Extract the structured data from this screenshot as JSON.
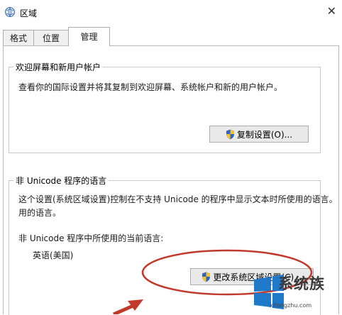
{
  "window": {
    "title": "区域",
    "close_icon": "close-icon"
  },
  "tabs": [
    {
      "label": "格式",
      "active": false
    },
    {
      "label": "位置",
      "active": false
    },
    {
      "label": "管理",
      "active": true
    }
  ],
  "welcome_group": {
    "title": "欢迎屏幕和新用户帐户",
    "description": "查看你的国际设置并将其复制到欢迎屏幕、系统帐户和新的用户帐户。",
    "copy_button": "复制设置(O)..."
  },
  "unicode_group": {
    "title": "非 Unicode 程序的语言",
    "description_line1": "这个设置(系统区域设置)控制在不支持 Unicode 的程序中显示文本时所使用的语言。",
    "description_line2": "用的语言。",
    "current_label": "非 Unicode 程序中所使用的当前语言:",
    "current_value": "英语(美国)",
    "change_button": "更改系统区域设置(C)..."
  },
  "watermark": {
    "text": "系统族",
    "url": "xitongzhu.com"
  },
  "colors": {
    "annotation": "#c0392b",
    "shield_blue": "#2e64c8",
    "shield_yellow": "#f2c230"
  }
}
